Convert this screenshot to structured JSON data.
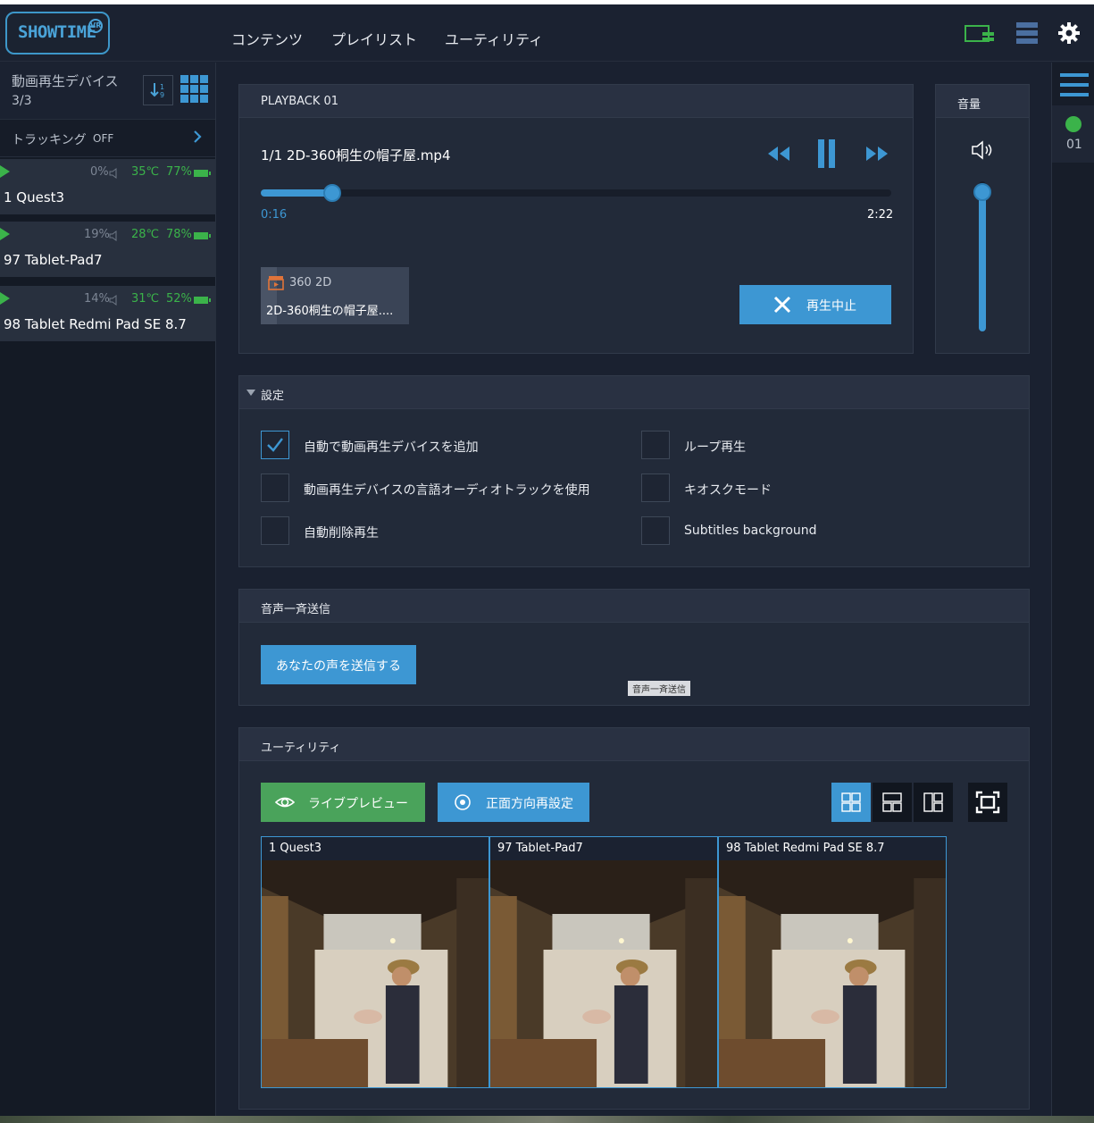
{
  "header": {
    "logo_text": "SHOWTIME",
    "logo_badge": "VR",
    "nav": [
      "コンテンツ",
      "プレイリスト",
      "ユーティリティ"
    ],
    "icons": [
      "cast-device-icon",
      "server-list-icon",
      "gear-icon"
    ]
  },
  "sidebar": {
    "title": "動画再生デバイス",
    "count": "3/3",
    "tracking_label": "トラッキング",
    "tracking_state": "OFF",
    "devices": [
      {
        "volume": "0%",
        "temp": "35℃",
        "battery": "77%",
        "name": "1  Quest3"
      },
      {
        "volume": "19%",
        "temp": "28℃",
        "battery": "78%",
        "name": "97  Tablet-Pad7"
      },
      {
        "volume": "14%",
        "temp": "31℃",
        "battery": "52%",
        "name": "98  Tablet Redmi Pad SE 8.7"
      }
    ]
  },
  "playback": {
    "title": "PLAYBACK 01",
    "track": "1/1  2D-360桐生の帽子屋.mp4",
    "progress": 0.113,
    "current_time": "0:16",
    "total_time": "2:22",
    "media_type": "360 2D",
    "media_name": "2D-360桐生の帽子屋....",
    "stop_label": "再生中止"
  },
  "volume": {
    "title": "音量",
    "level": 0.93
  },
  "settings": {
    "title": "設定",
    "options": [
      {
        "label": "自動で動画再生デバイスを追加",
        "checked": true
      },
      {
        "label": "ループ再生",
        "checked": false
      },
      {
        "label": "動画再生デバイスの言語オーディオトラックを使用",
        "checked": false
      },
      {
        "label": "キオスクモード",
        "checked": false
      },
      {
        "label": "自動削除再生",
        "checked": false
      },
      {
        "label": "Subtitles background",
        "checked": false
      }
    ]
  },
  "broadcast": {
    "title": "音声一斉送信",
    "button": "あなたの声を送信する",
    "tooltip": "音声一斉送信"
  },
  "utility": {
    "title": "ユーティリティ",
    "live_preview": "ライブプレビュー",
    "recenter": "正面方向再設定",
    "tiles": [
      "1 Quest3",
      "97 Tablet-Pad7",
      "98 Tablet Redmi Pad SE 8.7"
    ]
  },
  "rightbar": {
    "slot": "01"
  },
  "colors": {
    "accent_blue": "#3d97d3",
    "green": "#3bb34a",
    "panel": "#222a39",
    "background": "#1a2130"
  }
}
